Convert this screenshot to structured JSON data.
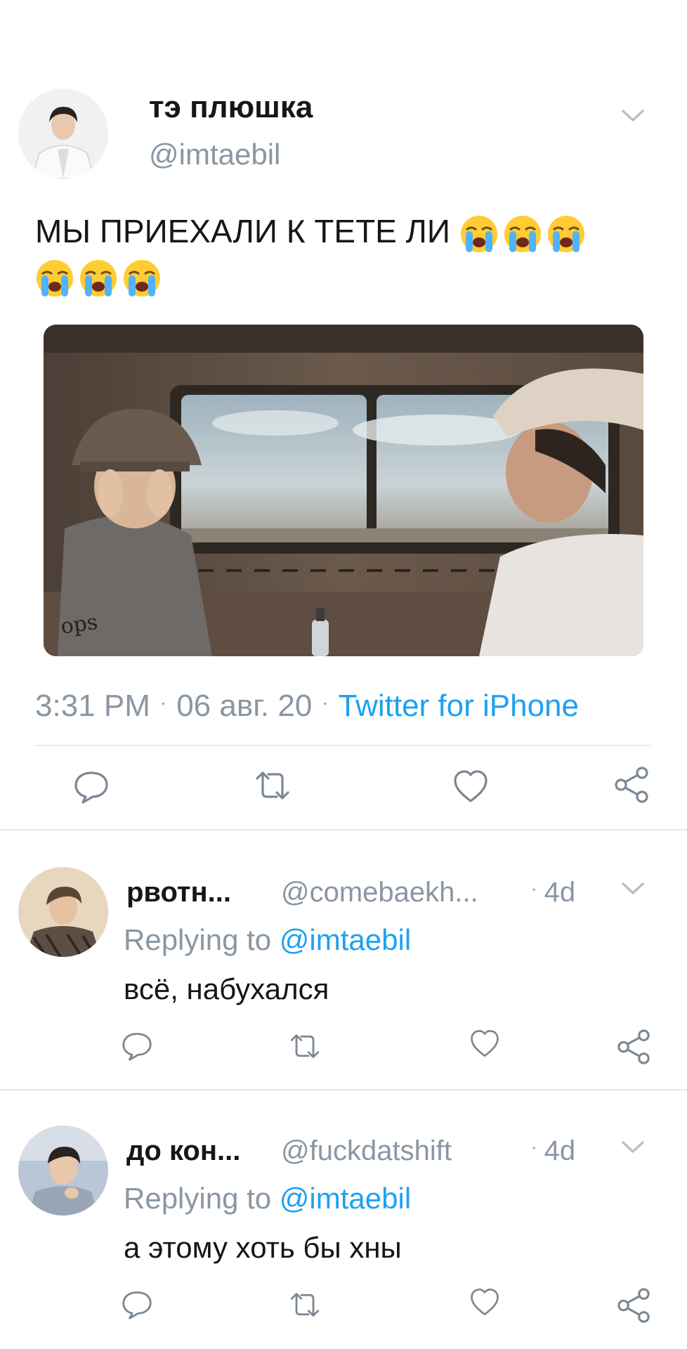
{
  "main_tweet": {
    "display_name": "тэ плюшка",
    "handle": "@imtaebil",
    "text": "МЫ ПРИЕХАЛИ К ТЕТЕ ЛИ",
    "emoji": [
      "loudly-crying-face",
      "loudly-crying-face",
      "loudly-crying-face",
      "loudly-crying-face",
      "loudly-crying-face",
      "loudly-crying-face"
    ],
    "time": "3:31 PM",
    "date": "06 авг. 20",
    "separator": "·",
    "source": "Twitter for iPhone",
    "media_watermark": "ops"
  },
  "actions": {
    "icons": [
      "reply-icon",
      "retweet-icon",
      "like-icon",
      "share-icon"
    ]
  },
  "replies": [
    {
      "display_name": "рвотн...",
      "handle": "@comebaekh...",
      "time": "4d",
      "replying_prefix": "Replying to",
      "replying_to": "@imtaebil",
      "text": "всё, набухался"
    },
    {
      "display_name": "до кон...",
      "handle": "@fuckdatshift",
      "time": "4d",
      "replying_prefix": "Replying to",
      "replying_to": "@imtaebil",
      "text": "а этому хоть бы хны"
    }
  ],
  "colors": {
    "accent": "#1da1f2",
    "secondary_text": "#8a96a3",
    "primary_text": "#14171a",
    "divider": "#e6ecf0"
  }
}
